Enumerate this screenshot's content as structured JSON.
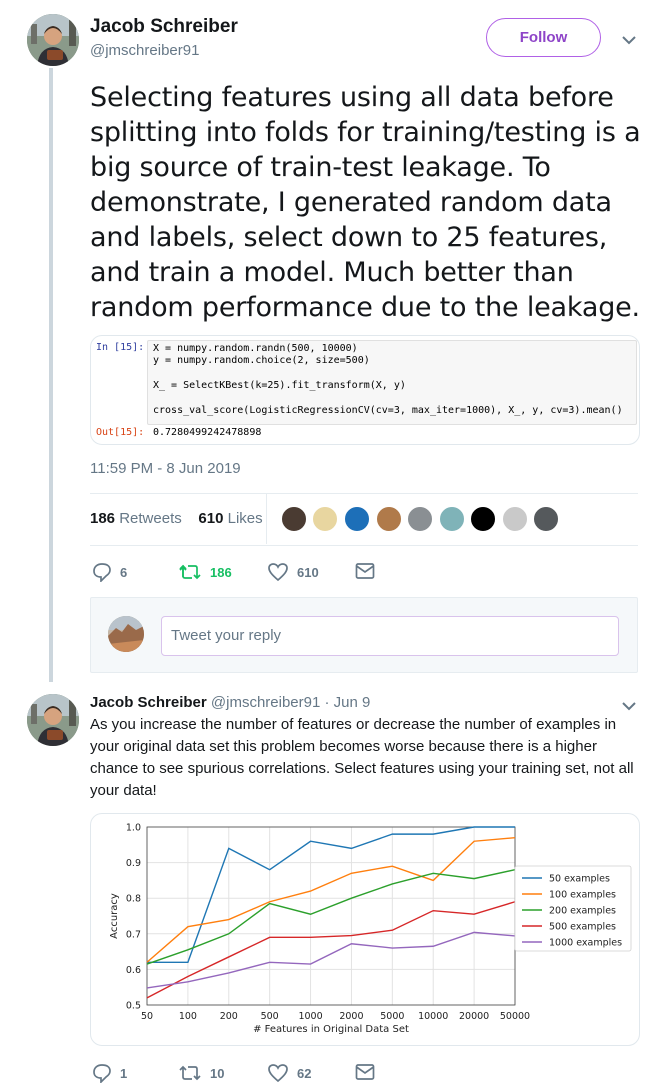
{
  "tweet": {
    "author_name": "Jacob Schreiber",
    "author_handle": "@jmschreiber91",
    "follow_label": "Follow",
    "text": "Selecting features using all data before splitting into folds for training/testing is a big source of train-test leakage. To demonstrate, I generated random data and labels, select down to 25 features, and train a model. Much better than random performance due to the leakage.",
    "code": {
      "in_prompt": "In [15]:",
      "out_prompt": "Out[15]:",
      "lines": [
        "X = numpy.random.randn(500, 10000)",
        "y = numpy.random.choice(2, size=500)",
        "X_ = SelectKBest(k=25).fit_transform(X, y)",
        "cross_val_score(LogisticRegressionCV(cv=3, max_iter=1000), X_, y, cv=3).mean()"
      ],
      "output": "0.7280499242478898"
    },
    "timestamp": "11:59 PM - 8 Jun 2019",
    "retweets_count": "186",
    "retweets_label": "Retweets",
    "likes_count": "610",
    "likes_label": "Likes",
    "actions": {
      "replies": "6",
      "retweets": "186",
      "likes": "610"
    }
  },
  "reply_composer": {
    "placeholder": "Tweet your reply"
  },
  "reply": {
    "author_name": "Jacob Schreiber",
    "author_handle": "@jmschreiber91",
    "date": "· Jun 9",
    "text": "As you increase the number of features or decrease the number of examples in your original data set this problem becomes worse because there is a higher chance to see spurious correlations. Select features using your training set, not all your data!",
    "actions": {
      "replies": "1",
      "retweets": "10",
      "likes": "62"
    }
  },
  "colors": {
    "accent": "#8e44c8",
    "retweet": "#17bf63",
    "muted": "#657786"
  },
  "chart_data": {
    "type": "line",
    "categories": [
      "50",
      "100",
      "200",
      "500",
      "1000",
      "2000",
      "5000",
      "10000",
      "20000",
      "50000"
    ],
    "xlabel": "# Features in Original Data Set",
    "ylabel": "Accuracy",
    "ylim": [
      0.5,
      1.0
    ],
    "yticks": [
      "0.5",
      "0.6",
      "0.7",
      "0.8",
      "0.9",
      "1.0"
    ],
    "legend_position": "center-right",
    "series": [
      {
        "name": "50 examples",
        "color": "#1f77b4",
        "values": [
          0.62,
          0.62,
          0.94,
          0.88,
          0.96,
          0.94,
          0.98,
          0.98,
          1.0,
          1.0
        ]
      },
      {
        "name": "100 examples",
        "color": "#ff7f0e",
        "values": [
          0.62,
          0.72,
          0.74,
          0.79,
          0.82,
          0.87,
          0.89,
          0.85,
          0.96,
          0.97
        ]
      },
      {
        "name": "200 examples",
        "color": "#2ca02c",
        "values": [
          0.615,
          0.655,
          0.7,
          0.785,
          0.755,
          0.8,
          0.84,
          0.87,
          0.855,
          0.88
        ]
      },
      {
        "name": "500 examples",
        "color": "#d62728",
        "values": [
          0.52,
          0.58,
          0.635,
          0.69,
          0.69,
          0.695,
          0.71,
          0.765,
          0.755,
          0.79
        ]
      },
      {
        "name": "1000 examples",
        "color": "#9467bd",
        "values": [
          0.548,
          0.565,
          0.59,
          0.62,
          0.615,
          0.672,
          0.66,
          0.665,
          0.704,
          0.694
        ]
      }
    ]
  }
}
